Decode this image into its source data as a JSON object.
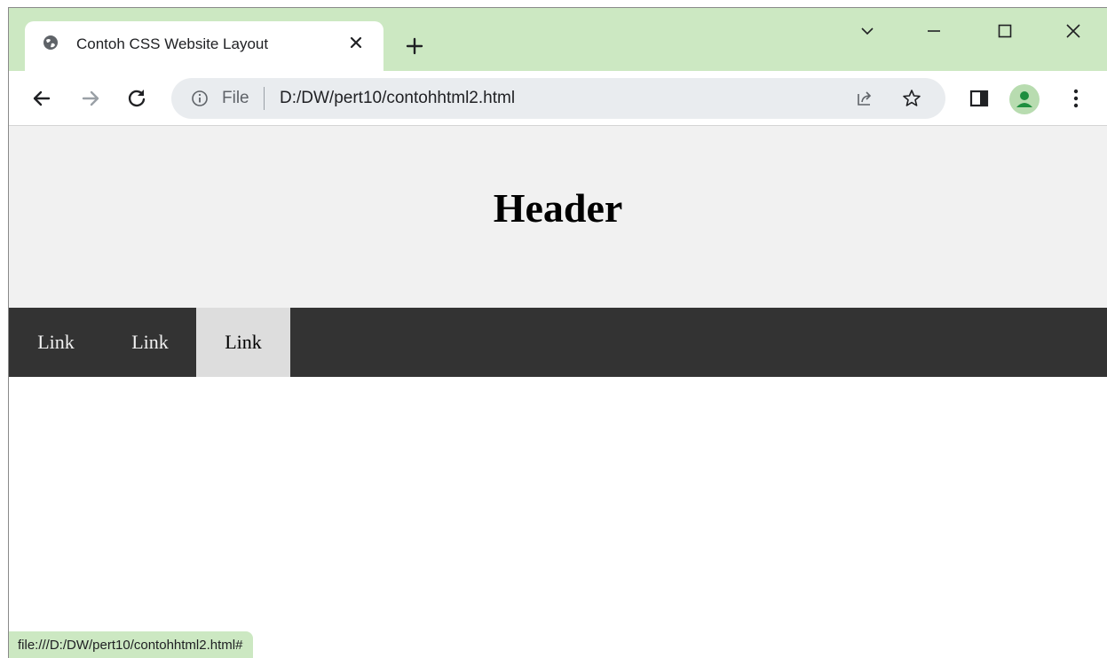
{
  "browser": {
    "tab": {
      "title": "Contoh CSS Website Layout"
    },
    "omnibox": {
      "scheme_label": "File",
      "url": "D:/DW/pert10/contohhtml2.html"
    },
    "status_url": "file:///D:/DW/pert10/contohhtml2.html#",
    "colors": {
      "tabstrip": "#cce8c2",
      "omnibox_bg": "#e9ecef",
      "avatar_bg": "#b8dcb0",
      "avatar_fg": "#1e8e3e"
    }
  },
  "page": {
    "header": {
      "title": "Header"
    },
    "nav": {
      "links": [
        {
          "label": "Link",
          "active": false
        },
        {
          "label": "Link",
          "active": false
        },
        {
          "label": "Link",
          "active": true
        }
      ]
    },
    "colors": {
      "header_bg": "#f1f1f1",
      "nav_bg": "#333333",
      "nav_active_bg": "#dddddd"
    }
  }
}
